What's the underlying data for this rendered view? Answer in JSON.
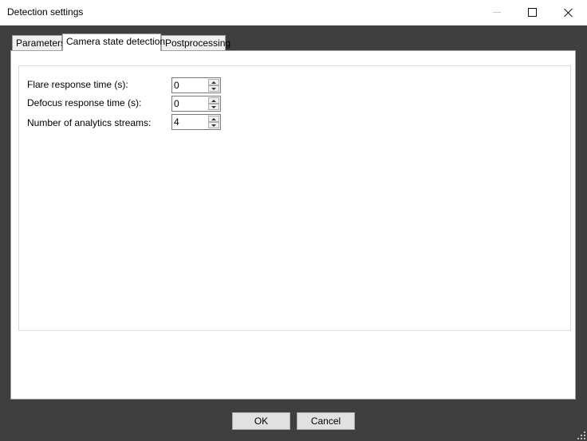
{
  "window": {
    "title": "Detection settings"
  },
  "tabs": [
    {
      "label": "Parameters",
      "selected": false
    },
    {
      "label": "Camera state detection",
      "selected": true
    },
    {
      "label": "Postprocessing",
      "selected": false
    }
  ],
  "fields": [
    {
      "label": "Flare response time (s):",
      "value": "0"
    },
    {
      "label": "Defocus response time (s):",
      "value": "0"
    },
    {
      "label": "Number of analytics streams:",
      "value": "4"
    }
  ],
  "buttons": {
    "ok_label": "OK",
    "cancel_label": "Cancel"
  },
  "colors": {
    "background": "#3f3f3f",
    "panel": "#ffffff",
    "button": "#e1e1e1"
  }
}
